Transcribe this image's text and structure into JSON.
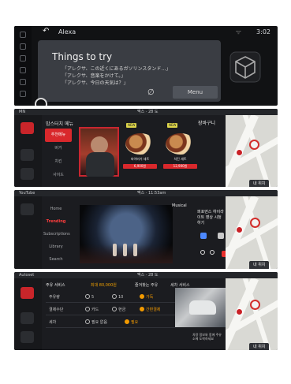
{
  "screen1": {
    "title": "Alexa",
    "clock": "3:02",
    "panel_title": "Things to try",
    "lines": [
      "「アレクサ、この近くにあるガソリンスタンド…」",
      "「アレクサ、音楽をかけて。」",
      "「アレクサ、今日の天気は？」"
    ],
    "mute_symbol": "∅",
    "menu": "Menu"
  },
  "screen2": {
    "status_left": "MN",
    "status_center": "맥스 · 28 도",
    "header": "맘스터치 메뉴",
    "cart": "장바구니",
    "categories": [
      "추천메뉴",
      "버거",
      "치킨",
      "사이드"
    ],
    "products": [
      {
        "name": "싸이버거 세트",
        "price": "6,900원"
      },
      {
        "name": "치킨 세트",
        "price": "12,900원"
      }
    ],
    "badge": "NEW"
  },
  "screen3": {
    "status_left": "YouTube",
    "status_center": "맥스 · 11:53am",
    "categories": [
      "Home",
      "Trending",
      "Subscriptions",
      "Library",
      "Search"
    ],
    "channel": "Musical",
    "description": "퍼포먼스 하이라이트 영상 시청하기"
  },
  "screen4": {
    "status_left": "Autoset",
    "status_center": "맥스 · 28 도",
    "title": "주유 서비스",
    "range": "최대 80,000원",
    "favorite": "즐겨찾는 주유",
    "shipping": "세차 서비스",
    "rows": [
      {
        "label": "주유량",
        "options": [
          "5",
          "10",
          "가득"
        ],
        "selected": 2
      },
      {
        "label": "결제수단",
        "options": [
          "카드",
          "현금",
          "간편결제"
        ],
        "selected": 2
      },
      {
        "label": "세차",
        "options": [
          "필요 없음",
          "필요"
        ],
        "selected": 1
      }
    ],
    "description": "차량 정보와 함께 주유소에 도착하세요"
  },
  "map": {
    "arrow": "▲",
    "chip": "내 위치"
  }
}
